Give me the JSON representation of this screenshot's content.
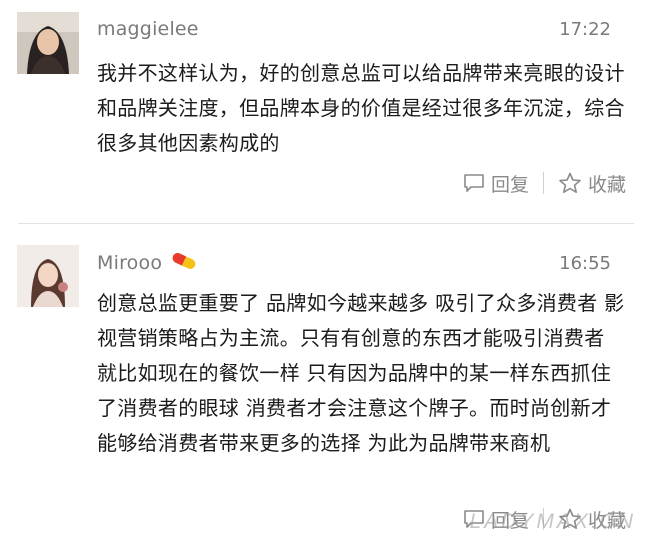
{
  "comments": [
    {
      "username": "maggielee",
      "time": "17:22",
      "text": "我并不这样认为，好的创意总监可以给品牌带来亮眼的设计和品牌关注度，但品牌本身的价值是经过很多年沉淀，综合很多其他因素构成的",
      "reply_label": "回复",
      "favorite_label": "收藏",
      "avatar_icon": "user-avatar-photo"
    },
    {
      "username": "Mirooo",
      "badge_icon": "pill-icon",
      "time": "16:55",
      "text": "创意总监更重要了 品牌如今越来越多 吸引了众多消费者 影视营销策略占为主流。只有有创意的东西才能吸引消费者 就比如现在的餐饮一样 只有因为品牌中的某一样东西抓住了消费者的眼球 消费者才会注意这个牌子。而时尚创新才能够给消费者带来更多的选择 为此为品牌带来商机",
      "reply_label": "回复",
      "favorite_label": "收藏",
      "avatar_icon": "user-avatar-photo"
    }
  ],
  "watermark": "LADYMAX.CN",
  "colors": {
    "meta": "#7a7a7a",
    "text": "#1b1b1b",
    "divider": "#e2e2e2",
    "pill_red": "#e83a2e",
    "pill_yellow": "#f4c319"
  }
}
